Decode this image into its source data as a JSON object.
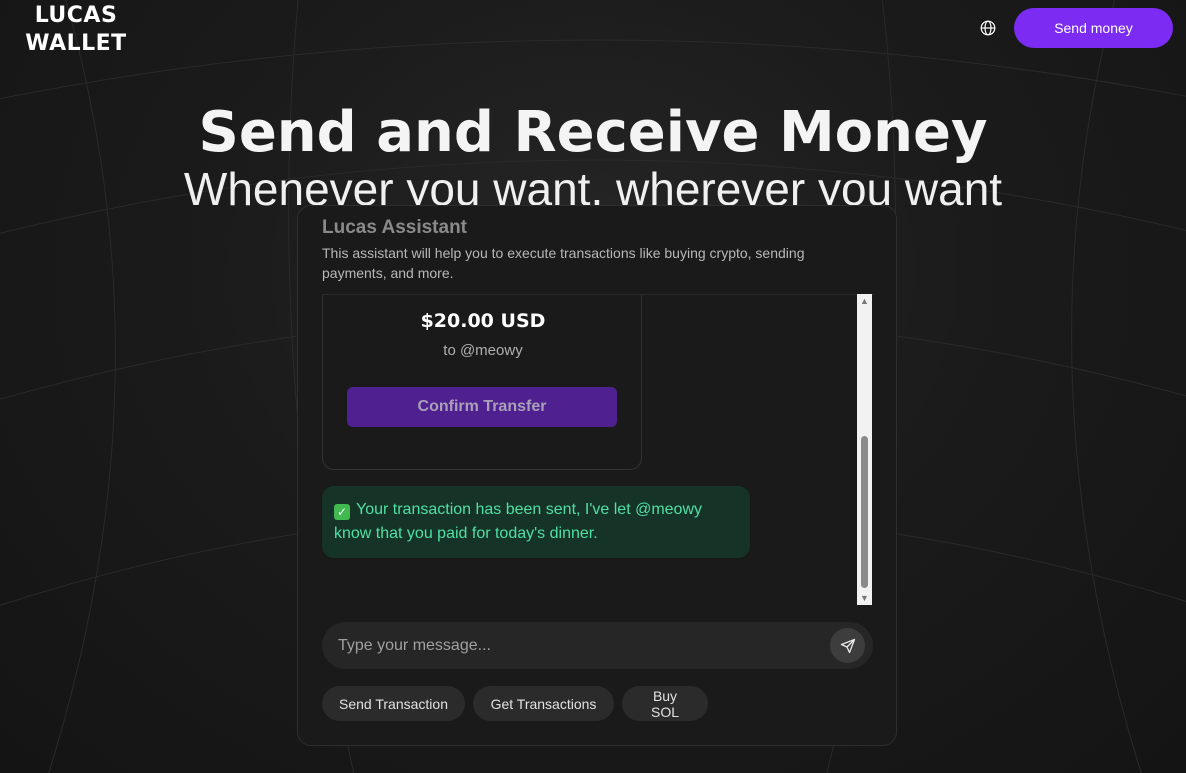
{
  "header": {
    "logo": "LUCAS WALLET",
    "send_money_label": "Send money",
    "language_icon": "globe-icon"
  },
  "hero": {
    "title": "Send and Receive Money",
    "subtitle": "Whenever you want, wherever you want"
  },
  "assistant": {
    "title": "Lucas Assistant",
    "description": "This assistant will help you to execute transactions like buying crypto, sending payments, and more.",
    "transfer": {
      "amount": "$20.00 USD",
      "recipient": "to @meowy",
      "confirm_label": "Confirm Transfer"
    },
    "success_message": "Your transaction has been sent, I've let @meowy know that you paid for today's dinner.",
    "success_icon": "check-mark-icon",
    "input_placeholder": "Type your message...",
    "send_icon": "paper-plane-icon",
    "quick_actions": [
      "Send Transaction",
      "Get Transactions",
      "Buy SOL"
    ]
  },
  "colors": {
    "accent": "#7c2cf2",
    "confirm_button": "#4f2190",
    "success_bg": "#153327",
    "success_text": "#4fe0a3",
    "background": "#161616"
  }
}
